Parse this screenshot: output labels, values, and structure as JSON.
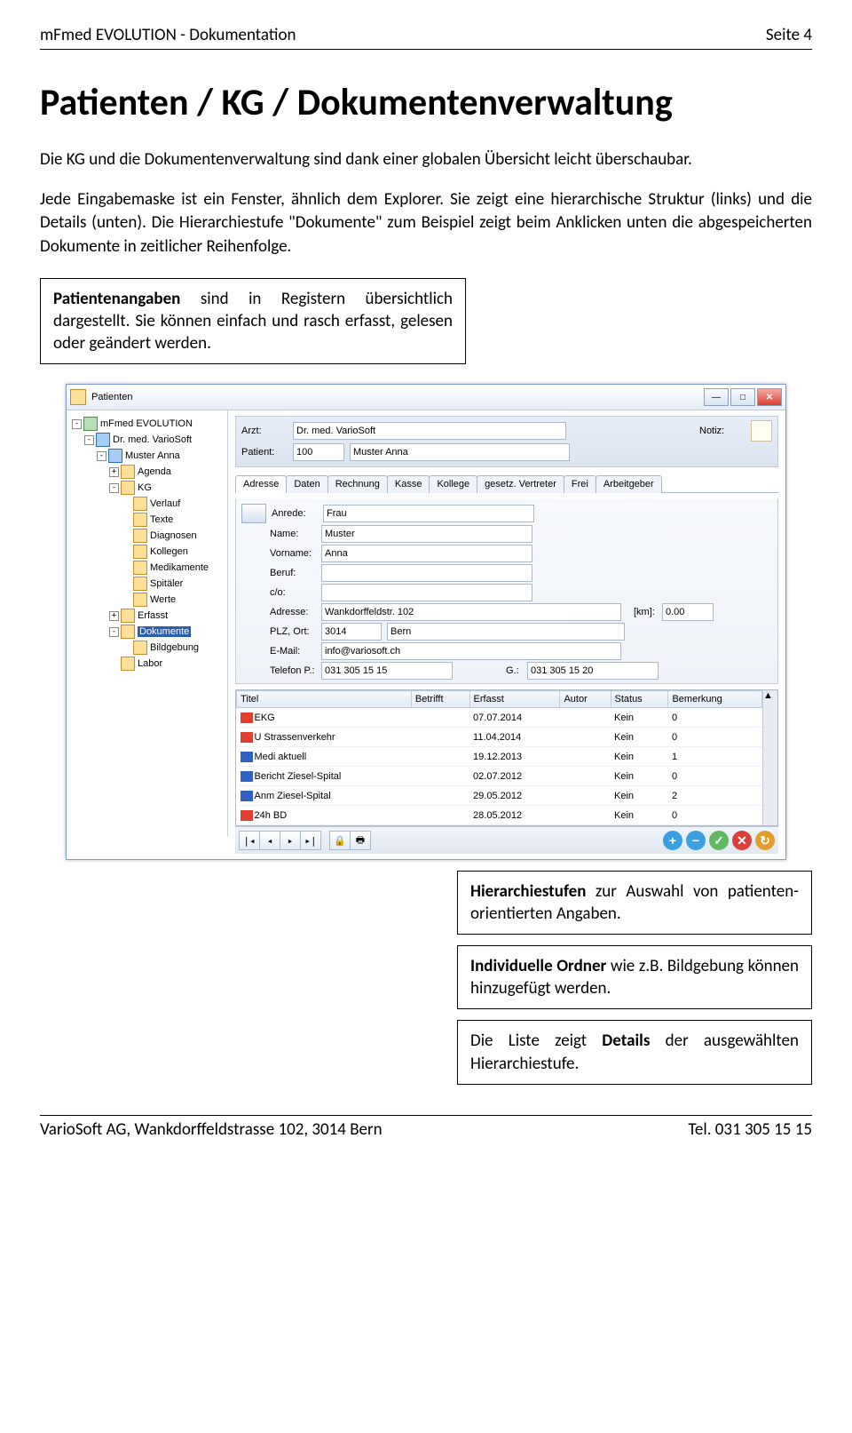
{
  "header": {
    "left": "mFmed EVOLUTION - Dokumentation",
    "right": "Seite 4"
  },
  "title": "Patienten / KG / Dokumentenverwaltung",
  "para1": "Die KG und die Dokumentenverwaltung sind dank einer globalen Übersicht leicht überschaubar.",
  "para2": "Jede Eingabemaske ist ein Fenster, ähnlich dem Explorer. Sie zeigt eine hierarchische Struktur (links) und die Details (unten). Die Hierarchiestufe \"Dokumente\" zum Beispiel zeigt beim Anklicken unten die abgespeicherten Dokumente in zeitlicher Reihenfolge.",
  "callout_top": {
    "pre": "Patientenangaben",
    "rest": " sind in Registern über­sichtlich dargestellt. Sie können einfach und rasch erfasst, gelesen oder geändert werden."
  },
  "callout_b1": {
    "pre": "Hierarchiestufen",
    "rest": " zur Auswahl von patienten-orientierten Angaben."
  },
  "callout_b2": {
    "pre": "Individuelle Ordner",
    "rest": " wie z.B. Bild­gebung können hinzugefügt werden."
  },
  "callout_b3": {
    "pre": "Die Liste zeigt ",
    "bold": "Details",
    "rest": " der ausge­wählten Hierarchiestufe."
  },
  "footer": {
    "left": "VarioSoft AG, Wankdorffeldstrasse 102, 3014 Bern",
    "right": "Tel. 031 305 15 15"
  },
  "win": {
    "title": "Patienten",
    "tree": [
      {
        "d": 0,
        "pm": "-",
        "i": "app",
        "t": "mFmed EVOLUTION"
      },
      {
        "d": 1,
        "pm": "-",
        "i": "person",
        "t": "Dr. med. VarioSoft"
      },
      {
        "d": 2,
        "pm": "-",
        "i": "person",
        "t": "Muster Anna"
      },
      {
        "d": 3,
        "pm": "+",
        "i": "folder",
        "t": "Agenda"
      },
      {
        "d": 3,
        "pm": "-",
        "i": "folder",
        "t": "KG"
      },
      {
        "d": 4,
        "pm": "",
        "i": "folder",
        "t": "Verlauf"
      },
      {
        "d": 4,
        "pm": "",
        "i": "folder",
        "t": "Texte"
      },
      {
        "d": 4,
        "pm": "",
        "i": "folder",
        "t": "Diagnosen"
      },
      {
        "d": 4,
        "pm": "",
        "i": "folder",
        "t": "Kollegen"
      },
      {
        "d": 4,
        "pm": "",
        "i": "folder",
        "t": "Medikamente"
      },
      {
        "d": 4,
        "pm": "",
        "i": "folder",
        "t": "Spitäler"
      },
      {
        "d": 4,
        "pm": "",
        "i": "folder",
        "t": "Werte"
      },
      {
        "d": 3,
        "pm": "+",
        "i": "folder",
        "t": "Erfasst"
      },
      {
        "d": 3,
        "pm": "-",
        "i": "folder",
        "t": "Dokumente",
        "sel": true
      },
      {
        "d": 4,
        "pm": "",
        "i": "folder",
        "t": "Bildgebung"
      },
      {
        "d": 3,
        "pm": "",
        "i": "folder",
        "t": "Labor"
      }
    ],
    "top": {
      "arzt_l": "Arzt:",
      "arzt_v": "Dr. med. VarioSoft",
      "pat_l": "Patient:",
      "pat_id": "100",
      "pat_v": "Muster Anna",
      "notiz_l": "Notiz:"
    },
    "tabs": [
      "Adresse",
      "Daten",
      "Rechnung",
      "Kasse",
      "Kollege",
      "gesetz. Vertreter",
      "Frei",
      "Arbeitgeber"
    ],
    "fields": {
      "anrede_l": "Anrede:",
      "anrede_v": "Frau",
      "name_l": "Name:",
      "name_v": "Muster",
      "vorname_l": "Vorname:",
      "vorname_v": "Anna",
      "beruf_l": "Beruf:",
      "beruf_v": "",
      "co_l": "c/o:",
      "co_v": "",
      "adresse_l": "Adresse:",
      "adresse_v": "Wankdorffeldstr. 102",
      "km_l": "[km]:",
      "km_v": "0.00",
      "plz_l": "PLZ, Ort:",
      "plz_v": "3014",
      "ort_v": "Bern",
      "email_l": "E-Mail:",
      "email_v": "info@variosoft.ch",
      "telp_l": "Telefon P.:",
      "telp_v": "031 305 15 15",
      "telg_l": "G.:",
      "telg_v": "031 305 15 20"
    },
    "grid": {
      "cols": [
        "Titel",
        "Betrifft",
        "Erfasst",
        "Autor",
        "Status",
        "Bemerkung"
      ],
      "rows": [
        {
          "i": "pdf",
          "t": "EKG",
          "b": "",
          "e": "07.07.2014",
          "a": "",
          "s": "Kein",
          "m": "0"
        },
        {
          "i": "pdf",
          "t": "U Strassenverkehr",
          "b": "",
          "e": "11.04.2014",
          "a": "",
          "s": "Kein",
          "m": "0"
        },
        {
          "i": "doc",
          "t": "Medi aktuell",
          "b": "",
          "e": "19.12.2013",
          "a": "",
          "s": "Kein",
          "m": "1"
        },
        {
          "i": "doc",
          "t": "Bericht Ziesel-Spital",
          "b": "",
          "e": "02.07.2012",
          "a": "",
          "s": "Kein",
          "m": "0"
        },
        {
          "i": "doc",
          "t": "Anm Ziesel-Spital",
          "b": "",
          "e": "29.05.2012",
          "a": "",
          "s": "Kein",
          "m": "2"
        },
        {
          "i": "pdf",
          "t": "24h BD",
          "b": "",
          "e": "28.05.2012",
          "a": "",
          "s": "Kein",
          "m": "0"
        }
      ]
    }
  }
}
